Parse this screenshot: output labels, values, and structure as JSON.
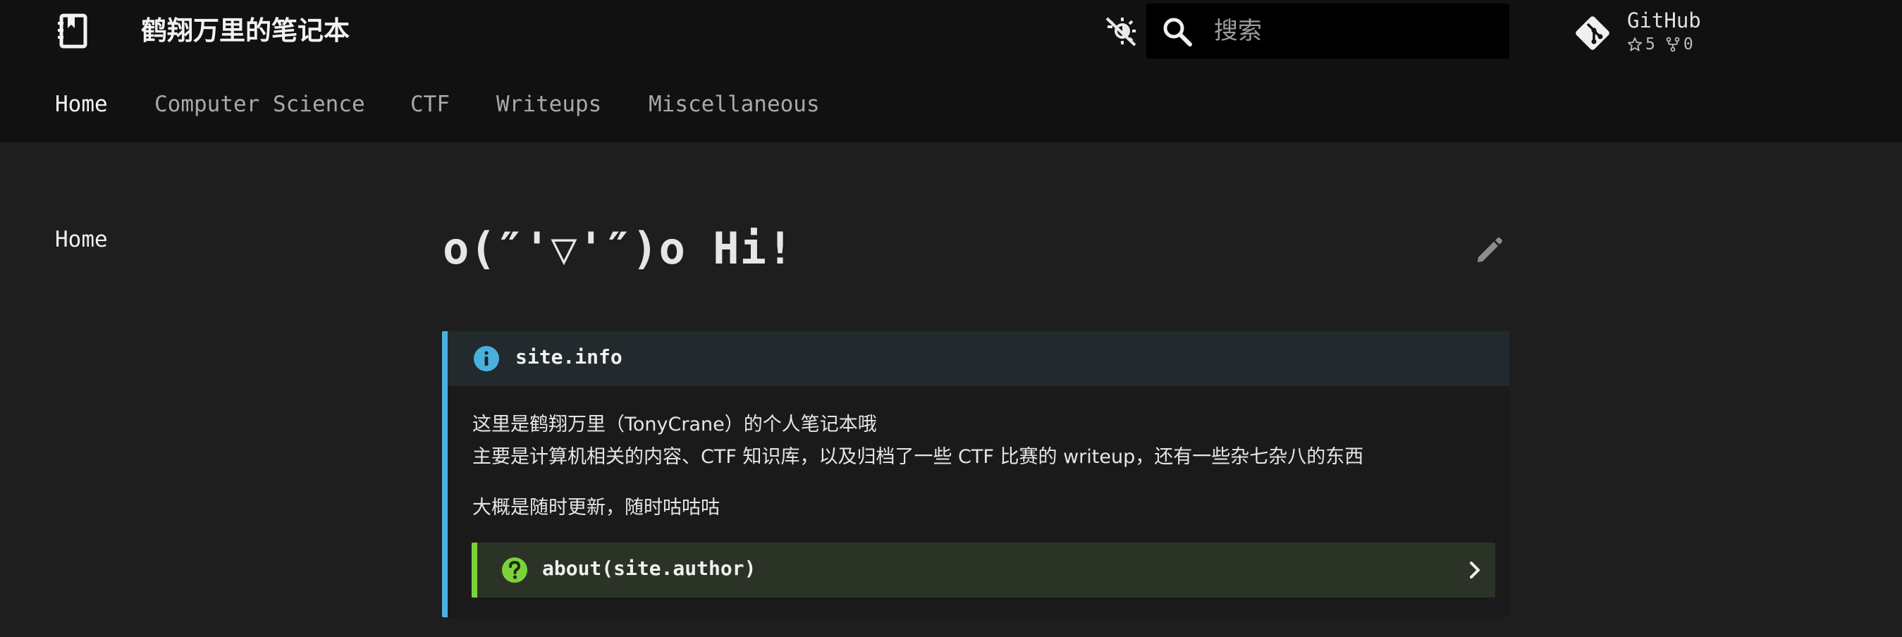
{
  "header": {
    "site_title": "鹤翔万里的笔记本",
    "search_placeholder": "搜索",
    "repo": {
      "name": "GitHub",
      "stars": "5",
      "forks": "0"
    }
  },
  "tabs": [
    {
      "label": "Home",
      "active": true
    },
    {
      "label": "Computer Science",
      "active": false
    },
    {
      "label": "CTF",
      "active": false
    },
    {
      "label": "Writeups",
      "active": false
    },
    {
      "label": "Miscellaneous",
      "active": false
    }
  ],
  "sidebar": {
    "items": [
      {
        "label": "Home"
      }
    ]
  },
  "page": {
    "title": "o(″'▽'″)o Hi!",
    "info_admonition": {
      "title": "site.info",
      "lines": [
        "这里是鹤翔万里（TonyCrane）的个人笔记本哦",
        "主要是计算机相关的内容、CTF 知识库，以及归档了一些 CTF 比赛的 writeup，还有一些杂七杂八的东西",
        "大概是随时更新，随时咕咕咕"
      ]
    },
    "question_admonition": {
      "title": "about(site.author)"
    }
  },
  "colors": {
    "header_bg": "#111111",
    "page_bg": "#1e1e1e",
    "info_accent": "#4ab1de",
    "question_accent": "#7bd23a"
  },
  "icons": {
    "logo": "notebook-icon",
    "theme": "theme-toggle-icon",
    "search": "search-icon",
    "repo": "git-icon",
    "edit": "pencil-icon",
    "info": "info-icon",
    "question": "question-icon",
    "expand": "chevron-right-icon"
  }
}
